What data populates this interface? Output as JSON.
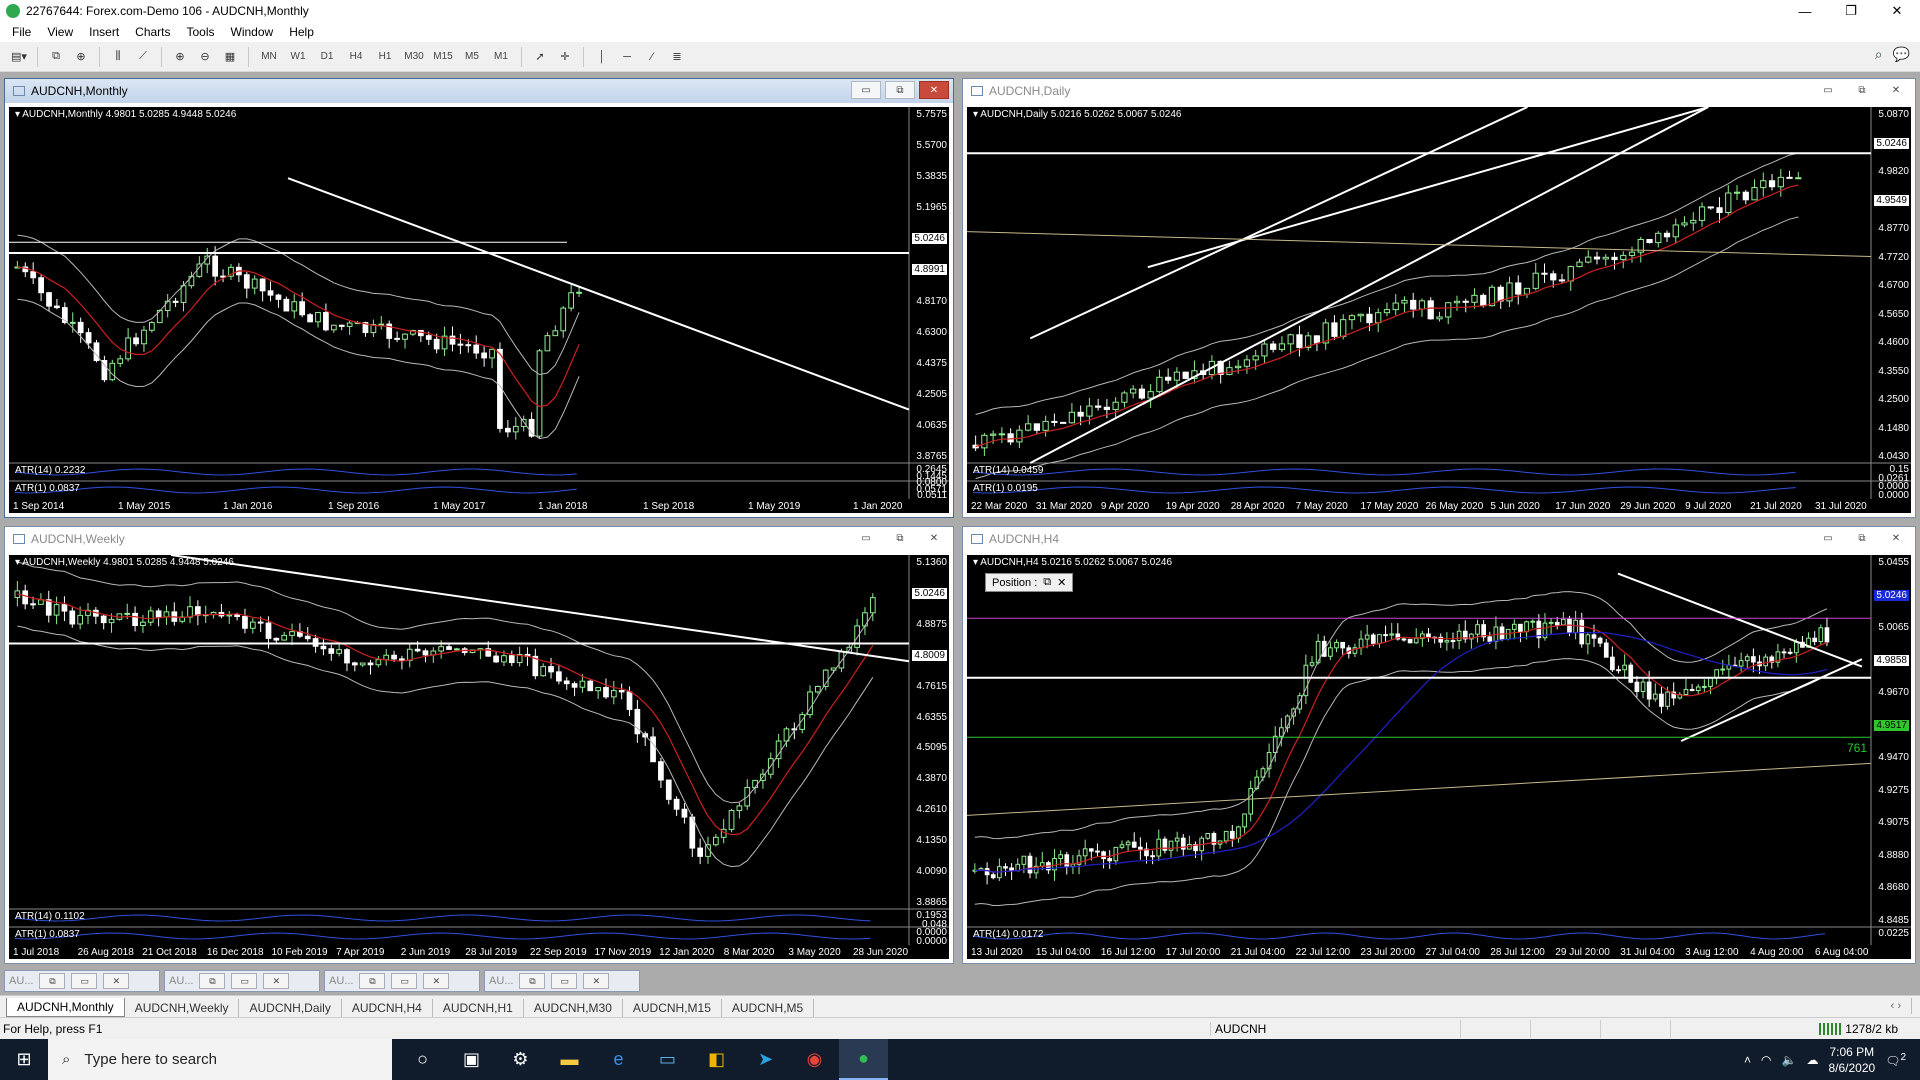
{
  "window": {
    "title": "22767644: Forex.com-Demo 106 - AUDCNH,Monthly",
    "controls": [
      "—",
      "❐",
      "✕"
    ]
  },
  "menu": [
    "File",
    "View",
    "Insert",
    "Charts",
    "Tools",
    "Window",
    "Help"
  ],
  "toolbar": {
    "timeframes": [
      "MN",
      "W1",
      "D1",
      "H4",
      "H1",
      "M30",
      "M15",
      "M5",
      "M1"
    ]
  },
  "charts": {
    "monthly": {
      "title": "AUDCNH,Monthly",
      "label": "AUDCNH,Monthly  4.9801 5.0285 4.9448 5.0246",
      "prices": [
        "5.7575",
        "5.5700",
        "5.3835",
        "5.1965",
        "5.0246",
        "4.8991",
        "4.8170",
        "4.6300",
        "4.4375",
        "4.2505",
        "4.0635",
        "3.8765"
      ],
      "atr14": "ATR(14) 0.2232",
      "atr1": "ATR(1) 0.0837",
      "atr_axis": [
        "0.2645",
        "0.1445",
        "0.0800",
        "0.0571",
        "0.0511"
      ],
      "dates": [
        "1 Sep 2014",
        "1 May 2015",
        "1 Jan 2016",
        "1 Sep 2016",
        "1 May 2017",
        "1 Jan 2018",
        "1 Sep 2018",
        "1 May 2019",
        "1 Jan 2020"
      ]
    },
    "daily": {
      "title": "AUDCNH,Daily",
      "label": "AUDCNH,Daily  5.0216 5.0262 5.0067 5.0246",
      "prices": [
        "5.0870",
        "5.0246",
        "4.9820",
        "4.9549",
        "4.8770",
        "4.7720",
        "4.6700",
        "4.5650",
        "4.4600",
        "4.3550",
        "4.2500",
        "4.1480",
        "4.0430"
      ],
      "atr14": "ATR(14) 0.0459",
      "atr1": "ATR(1) 0.0195",
      "atr_axis": [
        "0.15",
        "0.0261",
        "0.0000",
        "0.0000"
      ],
      "dates": [
        "22 Mar 2020",
        "31 Mar 2020",
        "9 Apr 2020",
        "19 Apr 2020",
        "28 Apr 2020",
        "7 May 2020",
        "17 May 2020",
        "26 May 2020",
        "5 Jun 2020",
        "17 Jun 2020",
        "29 Jun 2020",
        "9 Jul 2020",
        "21 Jul 2020",
        "31 Jul 2020"
      ]
    },
    "weekly": {
      "title": "AUDCNH,Weekly",
      "label": "AUDCNH,Weekly  4.9801 5.0285 4.9448 5.0246",
      "prices": [
        "5.1360",
        "5.0246",
        "4.8875",
        "4.8009",
        "4.7615",
        "4.6355",
        "4.5095",
        "4.3870",
        "4.2610",
        "4.1350",
        "4.0090",
        "3.8865"
      ],
      "atr14": "ATR(14) 0.1102",
      "atr1": "ATR(1) 0.0837",
      "atr_axis": [
        "0.1953",
        "0.048",
        "0.0000",
        "0.0000"
      ],
      "dates": [
        "1 Jul 2018",
        "26 Aug 2018",
        "21 Oct 2018",
        "16 Dec 2018",
        "10 Feb 2019",
        "7 Apr 2019",
        "2 Jun 2019",
        "28 Jul 2019",
        "22 Sep 2019",
        "17 Nov 2019",
        "12 Jan 2020",
        "8 Mar 2020",
        "3 May 2020",
        "28 Jun 2020"
      ]
    },
    "h4": {
      "title": "AUDCNH,H4",
      "label": "AUDCNH,H4  5.0216 5.0262 5.0067 5.0246",
      "position_label": "Position :",
      "level_text": "761",
      "prices": [
        "5.0455",
        "5.0246",
        "5.0065",
        "4.9858",
        "4.9670",
        "4.9517",
        "4.9470",
        "4.9275",
        "4.9075",
        "4.8880",
        "4.8680",
        "4.8485"
      ],
      "atr14": "ATR(14) 0.0172",
      "atr_axis": [
        "0.0225"
      ],
      "dates": [
        "13 Jul 2020",
        "15 Jul 04:00",
        "16 Jul 12:00",
        "17 Jul 20:00",
        "21 Jul 04:00",
        "22 Jul 12:00",
        "23 Jul 20:00",
        "27 Jul 04:00",
        "28 Jul 12:00",
        "29 Jul 20:00",
        "31 Jul 04:00",
        "3 Aug 12:00",
        "4 Aug 20:00",
        "6 Aug 04:00"
      ]
    }
  },
  "minimized": [
    "AU...",
    "AU...",
    "AU...",
    "AU..."
  ],
  "tabs": [
    "AUDCNH,Monthly",
    "AUDCNH,Weekly",
    "AUDCNH,Daily",
    "AUDCNH,H4",
    "AUDCNH,H1",
    "AUDCNH,M30",
    "AUDCNH,M15",
    "AUDCNH,M5"
  ],
  "status": {
    "help": "For Help, press F1",
    "symbol": "AUDCNH",
    "traffic": "1278/2 kb"
  },
  "taskbar": {
    "search_placeholder": "Type here to search",
    "time": "7:06 PM",
    "date": "8/6/2020",
    "notifications": "2"
  },
  "colors": {
    "chart_bg": "#000000",
    "bull_candle": "#90ee90",
    "bear_candle": "#ffffff",
    "ma_red": "#cc2020",
    "ma_blue": "#2020cc",
    "bands": "#c0c0c0"
  }
}
